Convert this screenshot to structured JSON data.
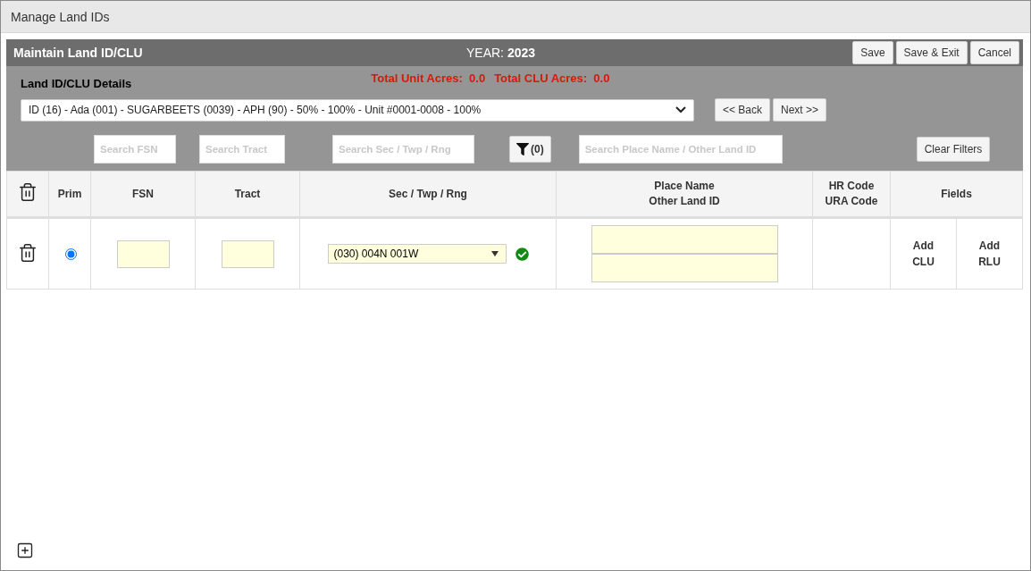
{
  "window": {
    "title": "Manage Land IDs"
  },
  "panel": {
    "title": "Maintain Land ID/CLU",
    "year": "YEAR: **2023**",
    "buttons": [
      "Save",
      "Save & Exit",
      "Cancel"
    ]
  },
  "details": {
    "title": "Land ID/CLU Details",
    "totals": [
      {
        "label": "Total Unit Acres:",
        "value": "0.0"
      },
      {
        "label": "Total CLU Acres:",
        "value": "0.0"
      }
    ],
    "land_select": {
      "value": "ID (16) - Ada (001) - SUGARBEETS (0039) - APH (90) - 50% - 100% - Unit #0001-0008 - 100%"
    },
    "nav_buttons": [
      "<< Back",
      "Next >>"
    ],
    "filters": [
      {
        "kind": "field",
        "placeholder": "Search FSN"
      },
      {
        "kind": "field",
        "placeholder": "Search Tract"
      },
      {
        "kind": "field",
        "placeholder": "Search Sec / Twp / Rng"
      },
      {
        "kind": "filter",
        "label": "(0)"
      },
      {
        "kind": "field",
        "placeholder": "Search Place Name / Other Land ID"
      }
    ],
    "clear_button": "Clear Filters"
  },
  "table": {
    "columns": [
      "Prim",
      "FSN",
      "Tract",
      "Sec / Twp / Rng",
      "Place Name\nOther Land ID",
      "HR Code\nURA Code",
      "Fields"
    ],
    "rows": [
      {
        "selected": true,
        "sec_twp_rng": "(030) 004N 001W",
        "valid": true,
        "links": [
          "Add CLU",
          "Add RLU"
        ]
      }
    ]
  }
}
